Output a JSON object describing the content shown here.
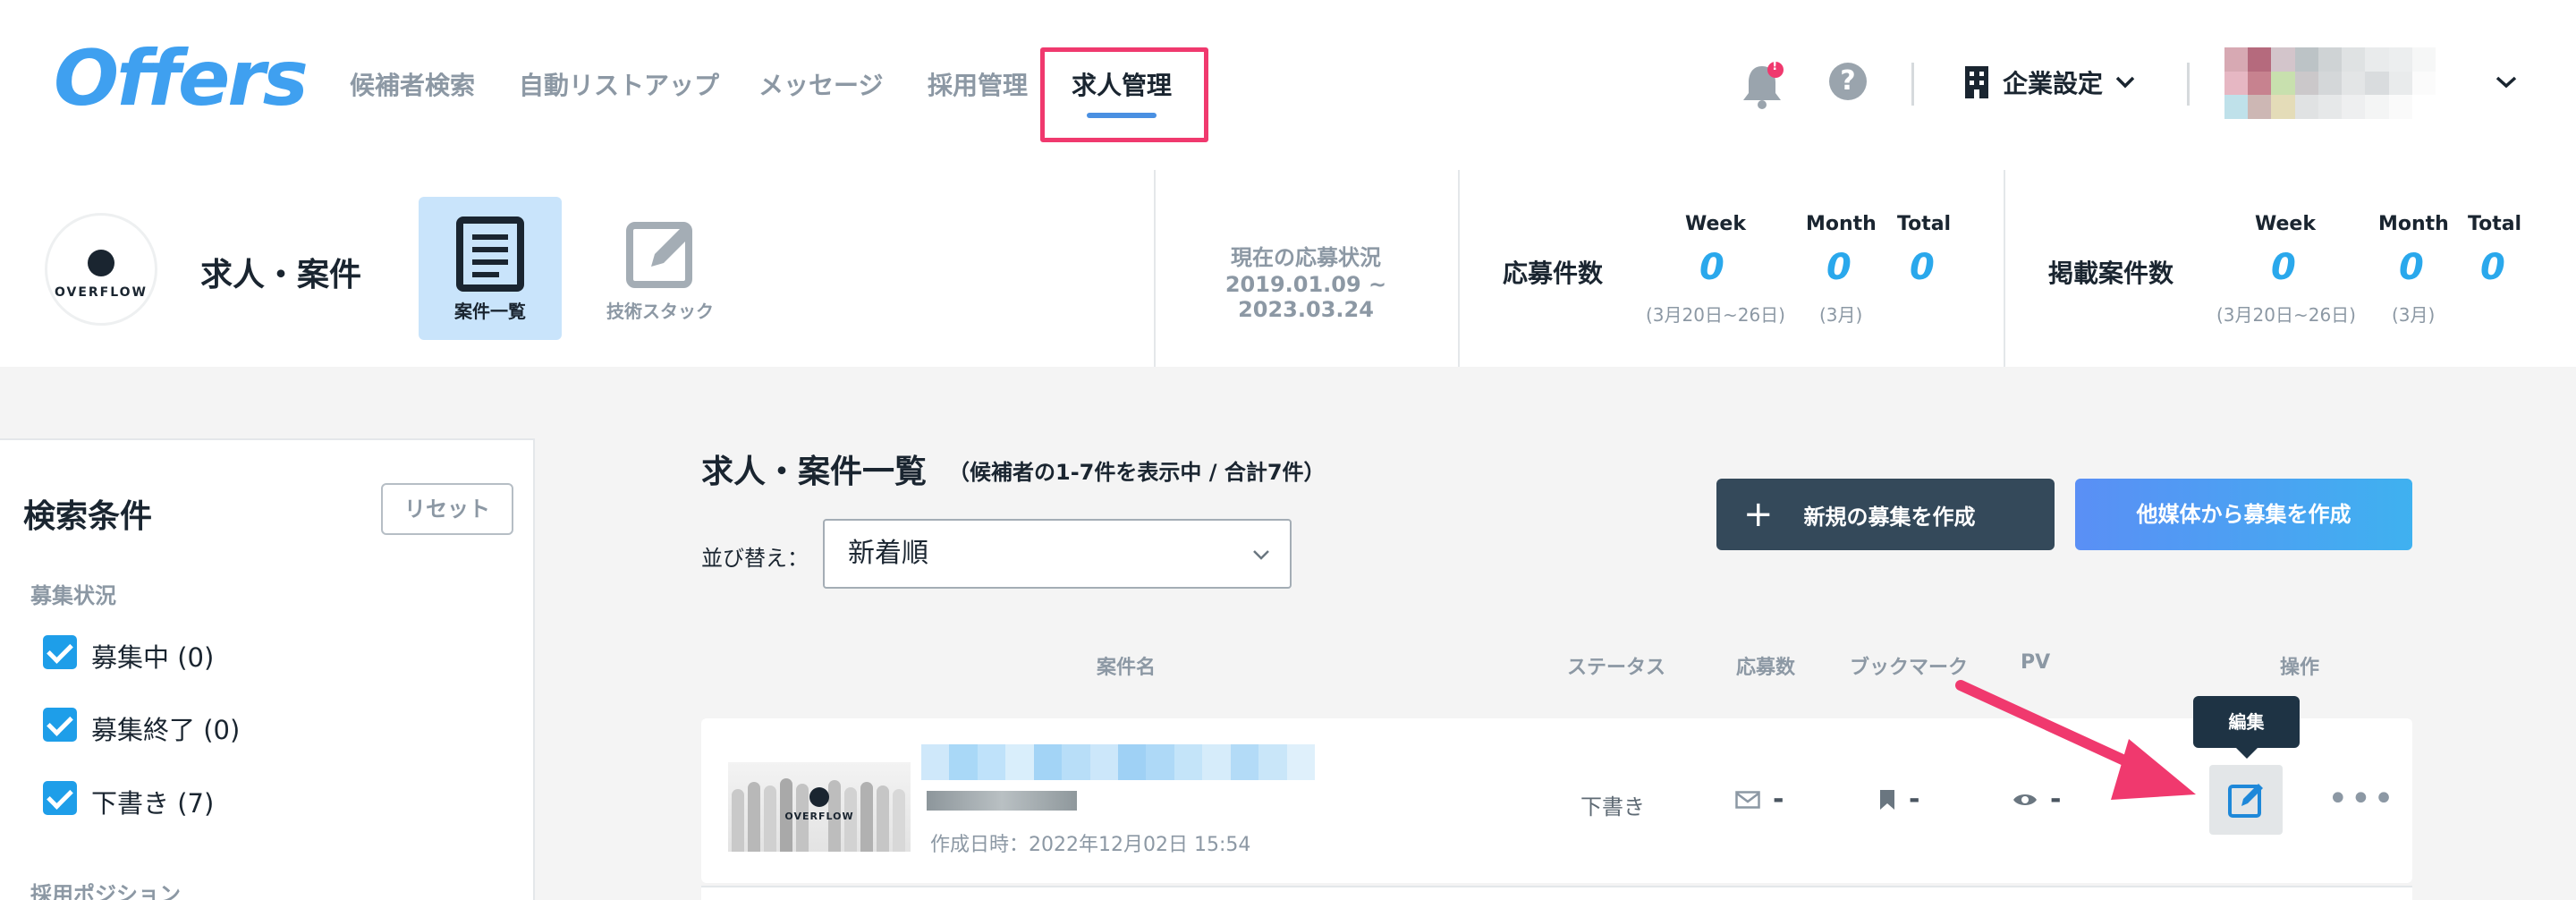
{
  "brand": {
    "logo_text": "Offers",
    "accent": "#3fa0f0",
    "highlight": "#f0396e"
  },
  "nav": {
    "items": [
      {
        "label": "候補者検索"
      },
      {
        "label": "自動リストアップ"
      },
      {
        "label": "メッセージ"
      },
      {
        "label": "採用管理"
      },
      {
        "label": "求人管理",
        "active": true
      }
    ]
  },
  "header_right": {
    "notification_badge": "!",
    "help_glyph": "?",
    "company_label": "企業設定"
  },
  "company": {
    "logo_text": "OVERFLOW",
    "page_title": "求人・案件"
  },
  "tabs": [
    {
      "label": "案件一覧",
      "active": true,
      "icon": "document-icon"
    },
    {
      "label": "技術スタック",
      "active": false,
      "icon": "edit-icon"
    }
  ],
  "stats": {
    "period_title": "現在の応募状況",
    "period_range": "2019.01.09 ~ 2023.03.24",
    "applications": {
      "label": "応募件数",
      "week_h": "Week",
      "month_h": "Month",
      "total_h": "Total",
      "week": "0",
      "month": "0",
      "total": "0",
      "week_sub": "(3月20日~26日)",
      "month_sub": "(3月)"
    },
    "listings": {
      "label": "掲載案件数",
      "week_h": "Week",
      "month_h": "Month",
      "total_h": "Total",
      "week": "0",
      "month": "0",
      "total": "0",
      "week_sub": "(3月20日~26日)",
      "month_sub": "(3月)"
    }
  },
  "sidebar": {
    "title": "検索条件",
    "reset_label": "リセット",
    "recruit_status_label": "募集状況",
    "filters": [
      {
        "label": "募集中 (0)",
        "checked": true
      },
      {
        "label": "募集終了 (0)",
        "checked": true
      },
      {
        "label": "下書き (7)",
        "checked": true
      }
    ],
    "position_label": "採用ポジション"
  },
  "list": {
    "title": "求人・案件一覧",
    "meta": "（候補者の1-7件を表示中 / 合計7件）",
    "sort_label": "並び替え：",
    "sort_value": "新着順",
    "new_button": "新規の募集を作成",
    "new_button_icon": "+",
    "import_button": "他媒体から募集を作成",
    "columns": {
      "name": "案件名",
      "status": "ステータス",
      "applications": "応募数",
      "bookmark": "ブックマーク",
      "pv": "PV",
      "actions": "操作"
    },
    "rows": [
      {
        "thumb_logo": "OVERFLOW",
        "created": "作成日時：2022年12月02日 15:54",
        "status": "下書き",
        "applications": "-",
        "bookmarks": "-",
        "pv": "-"
      }
    ],
    "edit_tooltip": "編集",
    "more_glyph": "•••"
  }
}
